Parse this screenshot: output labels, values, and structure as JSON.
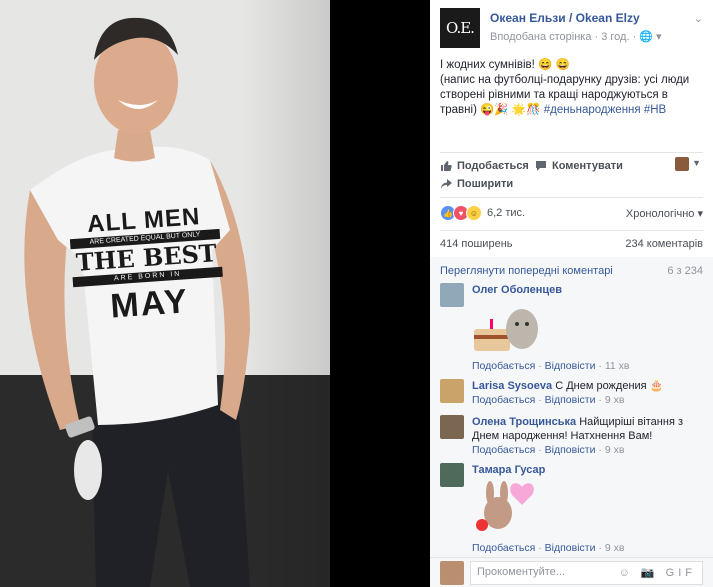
{
  "photo": {
    "shirt_line1": "ALL MEN",
    "shirt_line2": "ARE CREATED EQUAL BUT ONLY",
    "shirt_line3": "THE BEST",
    "shirt_line4": "ARE BORN IN",
    "shirt_line5": "MAY"
  },
  "post": {
    "page_logo": "O.E.",
    "page_name": "Океан Ельзи / Okean Elzy",
    "meta": "Вподобана сторінка · 3 год. · 🌐 ▾",
    "chevron": "⌄",
    "text_line1": "І жодних сумнівів! 😄 😄",
    "text_line2": "(напис на футболці-подарунку друзів: усі люди створені рівними та кращі народжуються в травні) 😜🎉 🌟🎊 ",
    "hashtags": "#деньнародження #НВ"
  },
  "actions": {
    "like": "Подобається",
    "comment": "Коментувати",
    "share": "Поширити"
  },
  "reactions": {
    "count": "6,2 тис.",
    "sort": "Хронологічно ▾"
  },
  "stats": {
    "shares": "414 поширень",
    "comments": "234 коментарів"
  },
  "comments": {
    "view_previous": "Переглянути попередні коментарі",
    "counter": "6 з 234",
    "items": [
      {
        "author": "Олег Оболенцев",
        "text": "",
        "like": "Подобається",
        "reply": "Відповісти",
        "time": "11 хв"
      },
      {
        "author": "Larisa Sysoeva",
        "text": "С Днем рождения 🎂",
        "like": "Подобається",
        "reply": "Відповісти",
        "time": "9 хв"
      },
      {
        "author": "Олена Трощинська",
        "text": "Найщиріші вітання з Днем народження! Натхнення Вам!",
        "like": "Подобається",
        "reply": "Відповісти",
        "time": "9 хв"
      },
      {
        "author": "Тамара Гусар",
        "text": "",
        "like": "Подобається",
        "reply": "Відповісти",
        "time": "9 хв"
      }
    ]
  },
  "compose": {
    "placeholder": "Прокоментуйте...",
    "icons": "☺ 📷 GIF"
  }
}
